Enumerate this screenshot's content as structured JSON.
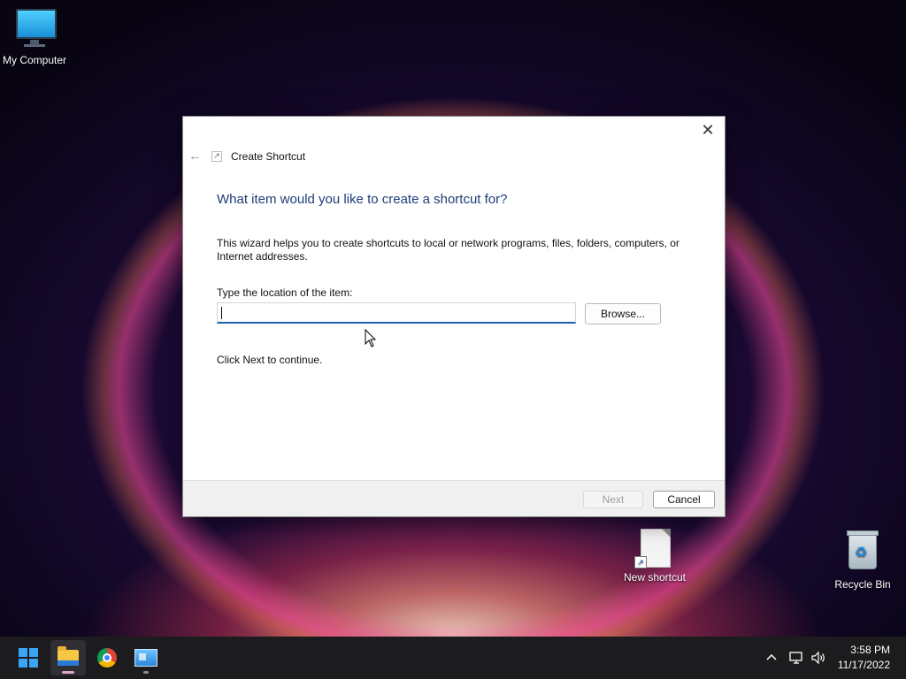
{
  "desktop": {
    "icons": [
      {
        "label": "My Computer"
      },
      {
        "label": "New shortcut"
      },
      {
        "label": "Recycle Bin"
      }
    ]
  },
  "dialog": {
    "title": "Create Shortcut",
    "heading": "What item would you like to create a shortcut for?",
    "description": "This wizard helps you to create shortcuts to local or network programs, files, folders, computers, or Internet addresses.",
    "location_label": "Type the location of the item:",
    "location_value": "",
    "browse_label": "Browse...",
    "continue_text": "Click Next to continue.",
    "next_label": "Next",
    "cancel_label": "Cancel",
    "close_glyph": "✕",
    "back_glyph": "←",
    "next_enabled": false
  },
  "taskbar": {
    "apps": [
      "start-icon",
      "file-explorer-icon",
      "chrome-icon",
      "control-panel-icon"
    ],
    "tray_icons": [
      "chevron-up-icon",
      "network-icon",
      "volume-icon"
    ],
    "time": "3:58 PM",
    "date": "11/17/2022"
  },
  "colors": {
    "heading": "#1c3c78",
    "input_focus": "#1a5fb4",
    "taskbar": "#1c1c1e"
  }
}
